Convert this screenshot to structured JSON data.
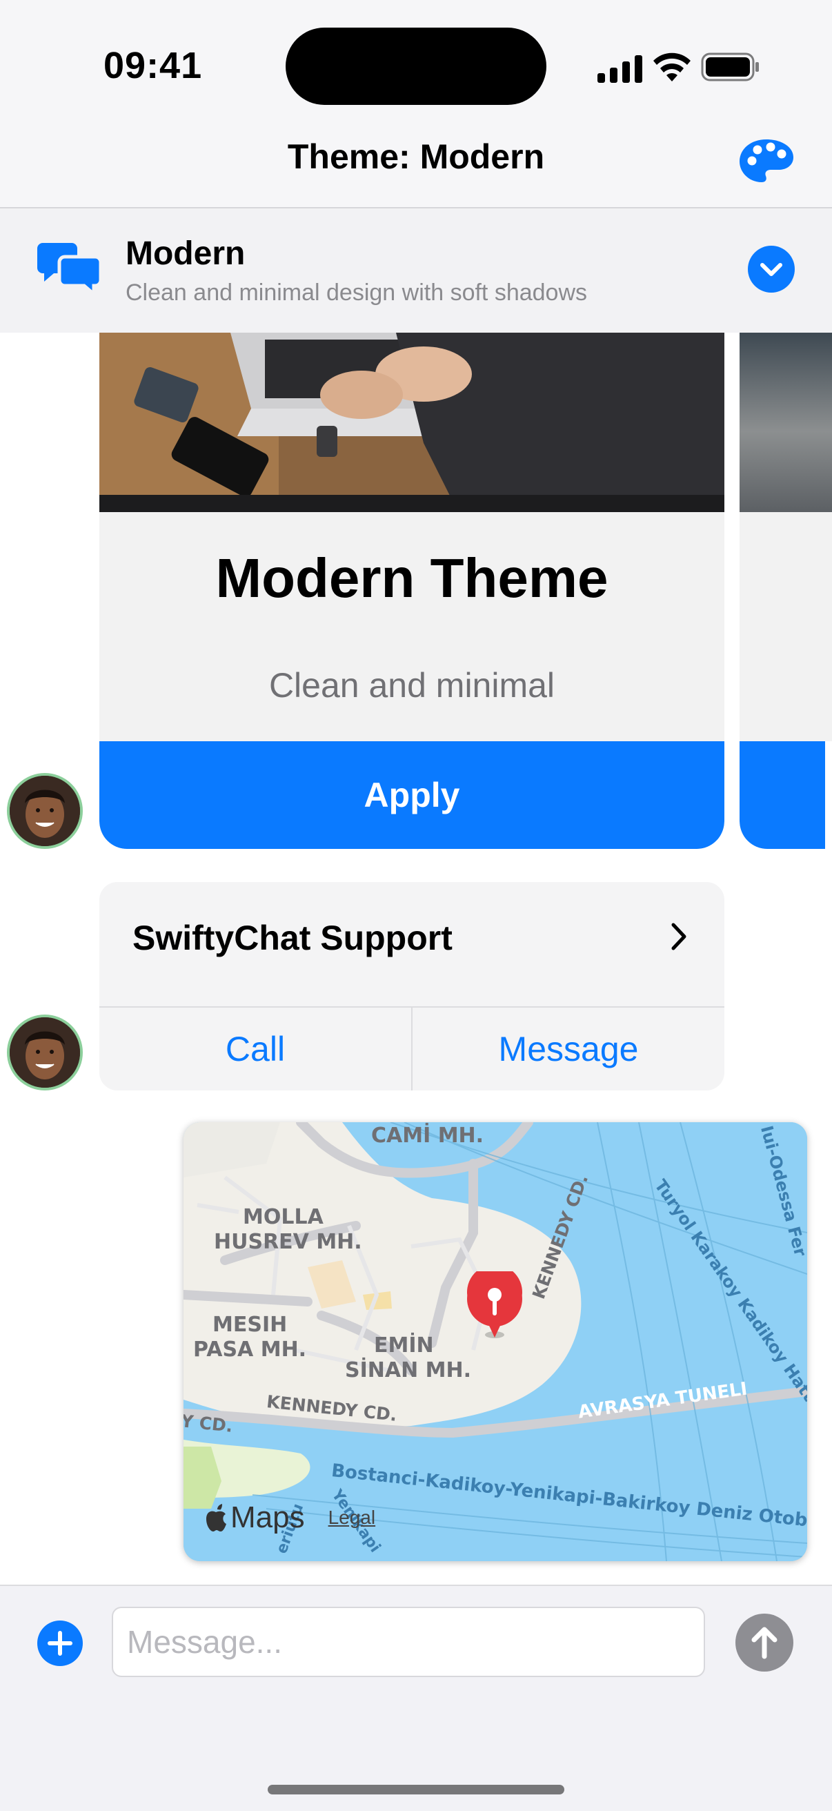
{
  "status_bar": {
    "time": "09:41"
  },
  "nav": {
    "title": "Theme: Modern",
    "palette_icon": "palette-icon"
  },
  "selector": {
    "name": "Modern",
    "description": "Clean and minimal design with soft shadows",
    "icon": "chat-bubbles-icon",
    "chevron_icon": "chevron-down-icon"
  },
  "theme_card": {
    "title": "Modern Theme",
    "subtitle": "Clean and minimal",
    "button_label": "Apply"
  },
  "contact_card": {
    "name": "SwiftyChat Support",
    "call_label": "Call",
    "message_label": "Message"
  },
  "map": {
    "labels": {
      "cami": "CAMİ MH.",
      "molla1": "MOLLA",
      "molla2": "HUSREV MH.",
      "mesih1": "MESIH",
      "mesih2": "PASA MH.",
      "emin1": "EMİN",
      "emin2": "SİNAN MH.",
      "kennedy_left": "KENNEDY CD.",
      "kennedy_edge": "Y CD.",
      "kennedy_vertical": "KENNEDY CD.",
      "avrasya": "AVRASYA TUNELI",
      "ferry_main": "Bostanci-Kadikoy-Yenikapi-Bakirkoy Deniz Otobus",
      "ferry_turyol": "Turyol Karakoy Kadikoy Hatt",
      "ferry_odessa": "Iui-Odessa Fer",
      "ferry_yenikapi": "Yenikapi",
      "ferry_bottom": "eriutu"
    },
    "brand": "Maps",
    "legal": "Legal"
  },
  "composer": {
    "placeholder": "Message...",
    "add_icon": "plus-icon",
    "send_icon": "arrow-up-icon"
  },
  "colors": {
    "accent": "#0A7AFF",
    "pin": "#E5363C",
    "water": "#8FD0F5"
  }
}
